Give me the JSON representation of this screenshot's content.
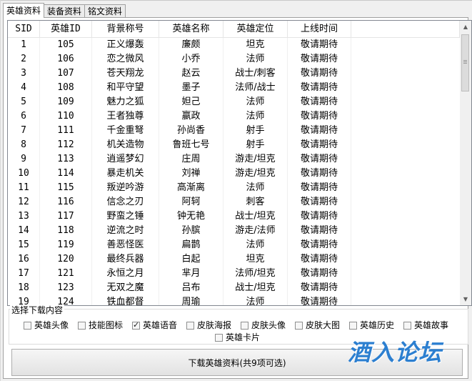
{
  "tabs": [
    {
      "label": "英雄资料",
      "active": true
    },
    {
      "label": "装备资料",
      "active": false
    },
    {
      "label": "铭文资料",
      "active": false
    }
  ],
  "table": {
    "headers": [
      "SID",
      "英雄ID",
      "背景称号",
      "英雄名称",
      "英雄定位",
      "上线时间"
    ],
    "rows": [
      [
        "1",
        "105",
        "正义爆轰",
        "廉颇",
        "坦克",
        "敬请期待"
      ],
      [
        "2",
        "106",
        "恋之微风",
        "小乔",
        "法师",
        "敬请期待"
      ],
      [
        "3",
        "107",
        "苍天翔龙",
        "赵云",
        "战士/刺客",
        "敬请期待"
      ],
      [
        "4",
        "108",
        "和平守望",
        "墨子",
        "法师/战士",
        "敬请期待"
      ],
      [
        "5",
        "109",
        "魅力之狐",
        "妲己",
        "法师",
        "敬请期待"
      ],
      [
        "6",
        "110",
        "王者独尊",
        "嬴政",
        "法师",
        "敬请期待"
      ],
      [
        "7",
        "111",
        "千金重弩",
        "孙尚香",
        "射手",
        "敬请期待"
      ],
      [
        "8",
        "112",
        "机关造物",
        "鲁班七号",
        "射手",
        "敬请期待"
      ],
      [
        "9",
        "113",
        "逍遥梦幻",
        "庄周",
        "游走/坦克",
        "敬请期待"
      ],
      [
        "10",
        "114",
        "暴走机关",
        "刘禅",
        "游走/坦克",
        "敬请期待"
      ],
      [
        "11",
        "115",
        "叛逆吟游",
        "高渐离",
        "法师",
        "敬请期待"
      ],
      [
        "12",
        "116",
        "信念之刃",
        "阿轲",
        "刺客",
        "敬请期待"
      ],
      [
        "13",
        "117",
        "野蛮之锤",
        "钟无艳",
        "战士/坦克",
        "敬请期待"
      ],
      [
        "14",
        "118",
        "逆流之时",
        "孙膑",
        "游走/法师",
        "敬请期待"
      ],
      [
        "15",
        "119",
        "善恶怪医",
        "扁鹊",
        "法师",
        "敬请期待"
      ],
      [
        "16",
        "120",
        "最终兵器",
        "白起",
        "坦克",
        "敬请期待"
      ],
      [
        "17",
        "121",
        "永恒之月",
        "芈月",
        "法师/坦克",
        "敬请期待"
      ],
      [
        "18",
        "123",
        "无双之魔",
        "吕布",
        "战士/坦克",
        "敬请期待"
      ],
      [
        "19",
        "124",
        "铁血都督",
        "周瑜",
        "法师",
        "敬请期待"
      ]
    ]
  },
  "download_group": {
    "title": "选择下载内容",
    "options": [
      {
        "label": "英雄头像",
        "checked": false
      },
      {
        "label": "技能图标",
        "checked": false
      },
      {
        "label": "英雄语音",
        "checked": true
      },
      {
        "label": "皮肤海报",
        "checked": false
      },
      {
        "label": "皮肤头像",
        "checked": false
      },
      {
        "label": "皮肤大图",
        "checked": false
      },
      {
        "label": "英雄历史",
        "checked": false
      },
      {
        "label": "英雄故事",
        "checked": false
      },
      {
        "label": "英雄卡片",
        "checked": false
      }
    ]
  },
  "download_button": {
    "label": "下载英雄资料(共9项可选)"
  },
  "watermark": {
    "text": "酒入论坛",
    "color": "#2c7fd0"
  }
}
